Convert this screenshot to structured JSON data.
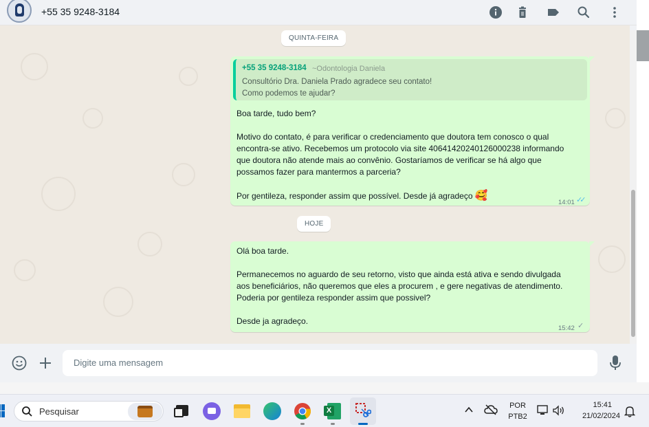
{
  "header": {
    "contact_name": "+55 35 9248-3184",
    "icons": [
      "info-icon",
      "trash-icon",
      "label-icon",
      "search-icon",
      "menu-icon"
    ]
  },
  "chat": {
    "date_1": "QUINTA-FEIRA",
    "date_2": "HOJE",
    "message_1": {
      "quote_sender": "+55 35 9248-3184",
      "quote_pushname": "~Odontologia Daniela",
      "quote_lines": [
        "Consultório Dra. Daniela Prado agradece seu contato!",
        "Como podemos te ajudar?"
      ],
      "lines": [
        "Boa tarde, tudo bem?",
        "Motivo do contato, é para verificar o credenciamento que doutora tem conosco o qual",
        "encontra-se ativo. Recebemos um protocolo via site  40641420240126000238 informando",
        "que doutora não atende mais ao convênio. Gostaríamos de verificar se há algo que",
        "possamos fazer para mantermos a parceria?",
        "Por gentileza, responder assim que possível. Desde já agradeço"
      ],
      "emoji": "🥰",
      "time": "14:01",
      "ticks": "✓✓"
    },
    "message_2": {
      "lines": [
        "Olá boa tarde.",
        "Permanecemos no aguardo de seu retorno, visto que ainda está ativa e sendo divulgada",
        "aos beneficiários, não queremos que eles a procurem , e gere negativas de atendimento.",
        "Poderia por gentileza responder assim que possivel?",
        "Desde ja agradeço."
      ],
      "time": "15:42",
      "ticks": "✓"
    }
  },
  "composer": {
    "placeholder": "Digite uma mensagem"
  },
  "taskbar": {
    "search_placeholder": "Pesquisar",
    "language_top": "POR",
    "language_bottom": "PTB2",
    "clock_time": "15:41",
    "clock_date": "21/02/2024"
  },
  "colors": {
    "outgoing_bubble": "#d9fdd3",
    "quote_accent": "#06cf9c",
    "read_ticks": "#53bdeb",
    "chat_background": "#efeae2"
  }
}
